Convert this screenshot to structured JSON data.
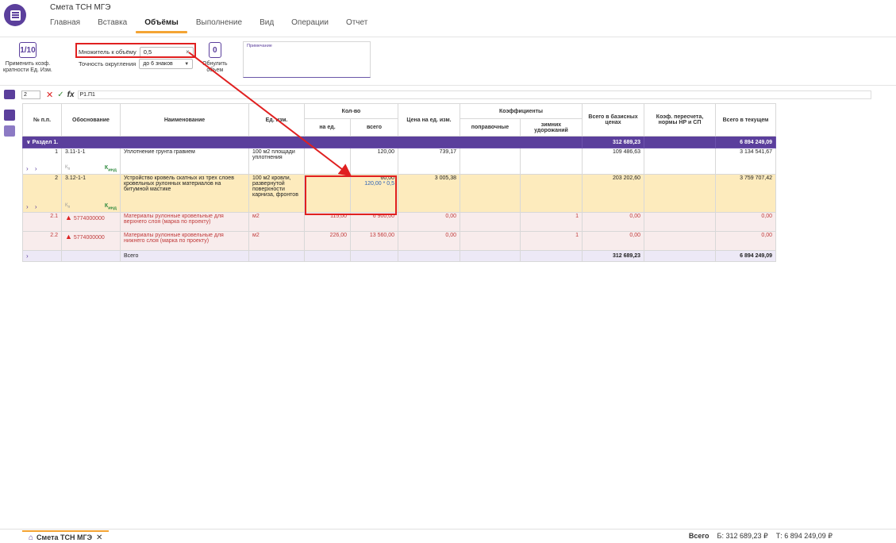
{
  "app": {
    "title": "Смета ТСН МГЭ"
  },
  "tabs": [
    "Главная",
    "Вставка",
    "Объёмы",
    "Выполнение",
    "Вид",
    "Операции",
    "Отчет"
  ],
  "ribbon": {
    "apply_coef_icon": "1/10",
    "apply_coef_label": "Применить коэф.\nкратности Ед. Изм.",
    "multiplier_label": "Множитель к объёму",
    "multiplier_value": "0,5",
    "rounding_label": "Точность округления",
    "rounding_value": "до 6 знаков",
    "reset_icon": "0",
    "reset_label": "Обнулить\nобъем",
    "note_placeholder": "Примечание"
  },
  "formula_bar": {
    "cell": "2",
    "formula": "P1.П1"
  },
  "table": {
    "headers": {
      "num": "№ п.п.",
      "basis": "Обоснование",
      "name": "Наименование",
      "unit": "Ед. изм.",
      "qty": "Кол-во",
      "qty_unit": "на ед.",
      "qty_total": "всего",
      "price": "Цена на ед. изм.",
      "coefs": "Коэффициенты",
      "coef_corr": "поправочные",
      "coef_winter": "зимних удорожаний",
      "base": "Всего в базисных ценах",
      "recalc": "Коэф. пересчета, нормы НР и СП",
      "current": "Всего в текущем"
    },
    "section": {
      "label": "Раздел 1.",
      "base": "312 689,23",
      "current": "6 894 249,09"
    },
    "rows": [
      {
        "num": "1",
        "basis": "3.11-1-1",
        "name": "Уплотнение грунта гравием",
        "unit": "100 м2 площади уплотнения",
        "qty_total": "120,00",
        "price": "739,17",
        "base": "109 486,63",
        "current": "3 134 541,67"
      },
      {
        "num": "2",
        "basis": "3.12-1-1",
        "name": "Устройство кровель скатных из трех слоев кровельных рулонных материалов на битумной мастике",
        "unit": "100 м2 кровли, развернутой поверхности карниза, фронтов",
        "qty_total": "60,00",
        "qty_formula": "120,00 * 0,5",
        "price": "3 005,38",
        "base": "203 202,60",
        "current": "3 759 707,42"
      }
    ],
    "materials": [
      {
        "num": "2.1",
        "basis": "5774000000",
        "name": "Материалы рулонные кровельные для верхнего слоя (марка по проекту)",
        "unit": "м2",
        "qty_unit": "115,00",
        "qty_total": "6 900,00",
        "price": "0,00",
        "winter": "1",
        "base": "0,00",
        "current": "0,00"
      },
      {
        "num": "2.2",
        "basis": "5774000000",
        "name": "Материалы рулонные кровельные для нижнего слоя (марка по проекту)",
        "unit": "м2",
        "qty_unit": "226,00",
        "qty_total": "13 560,00",
        "price": "0,00",
        "winter": "1",
        "base": "0,00",
        "current": "0,00"
      }
    ],
    "kn": "К",
    "kn_sub": "п",
    "kind": "К",
    "kind_sub": "инд",
    "total": {
      "label": "Всего",
      "base": "312 689,23",
      "current": "6 894 249,09"
    }
  },
  "bottom": {
    "tab_label": "Смета ТСН МГЭ",
    "total_label": "Всего",
    "base_total": "Б: 312 689,23 ₽",
    "current_total": "Т: 6 894 249,09 ₽"
  },
  "colors": {
    "accent": "#5b3f9c",
    "highlight": "#e02020",
    "tab_underline": "#f4a433"
  }
}
